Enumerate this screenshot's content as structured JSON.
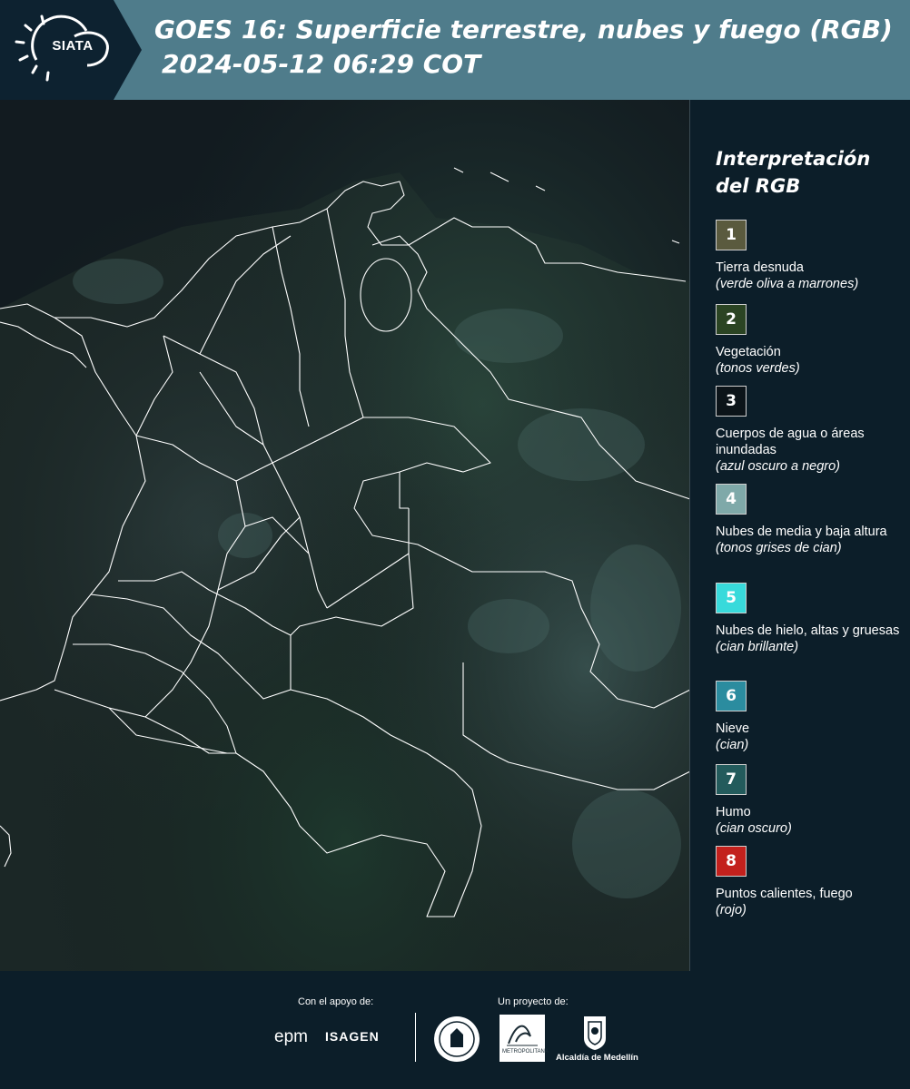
{
  "header": {
    "logo_text": "SIATA",
    "title_line1": "GOES 16: Superficie terrestre, nubes y fuego (RGB)",
    "title_line2": "2024-05-12 06:29 COT"
  },
  "legend": {
    "title": "Interpretación del RGB",
    "items": [
      {
        "number": "1",
        "label": "Tierra desnuda",
        "desc": "(verde oliva a marrones)",
        "color": "#5a5a3e"
      },
      {
        "number": "2",
        "label": "Vegetación",
        "desc": "(tonos verdes)",
        "color": "#2b4423"
      },
      {
        "number": "3",
        "label": "Cuerpos de agua o áreas inundadas",
        "desc": "(azul oscuro a negro)",
        "color": "#0c1419"
      },
      {
        "number": "4",
        "label": "Nubes de media y baja altura",
        "desc": "(tonos grises de cian)",
        "color": "#7fa9a9"
      },
      {
        "number": "5",
        "label": "Nubes de hielo, altas y gruesas",
        "desc": "(cian brillante)",
        "color": "#38dadb"
      },
      {
        "number": "6",
        "label": "Nieve",
        "desc": "(cian)",
        "color": "#2b8c9f"
      },
      {
        "number": "7",
        "label": "Humo",
        "desc": "(cian oscuro)",
        "color": "#235b5c"
      },
      {
        "number": "8",
        "label": "Puntos calientes, fuego",
        "desc": "(rojo)",
        "color": "#c3211d"
      }
    ]
  },
  "footer": {
    "support_label": "Con el apoyo de:",
    "project_label": "Un proyecto de:",
    "sponsor1": "epm",
    "sponsor2": "ISAGEN",
    "partner_amva": "METROPOLITANA",
    "partner_alcaldia": "Alcaldía de Medellín"
  },
  "colors": {
    "header_bg": "#4f7c8b",
    "page_bg": "#0c1e29",
    "boundary": "#ffffff"
  }
}
